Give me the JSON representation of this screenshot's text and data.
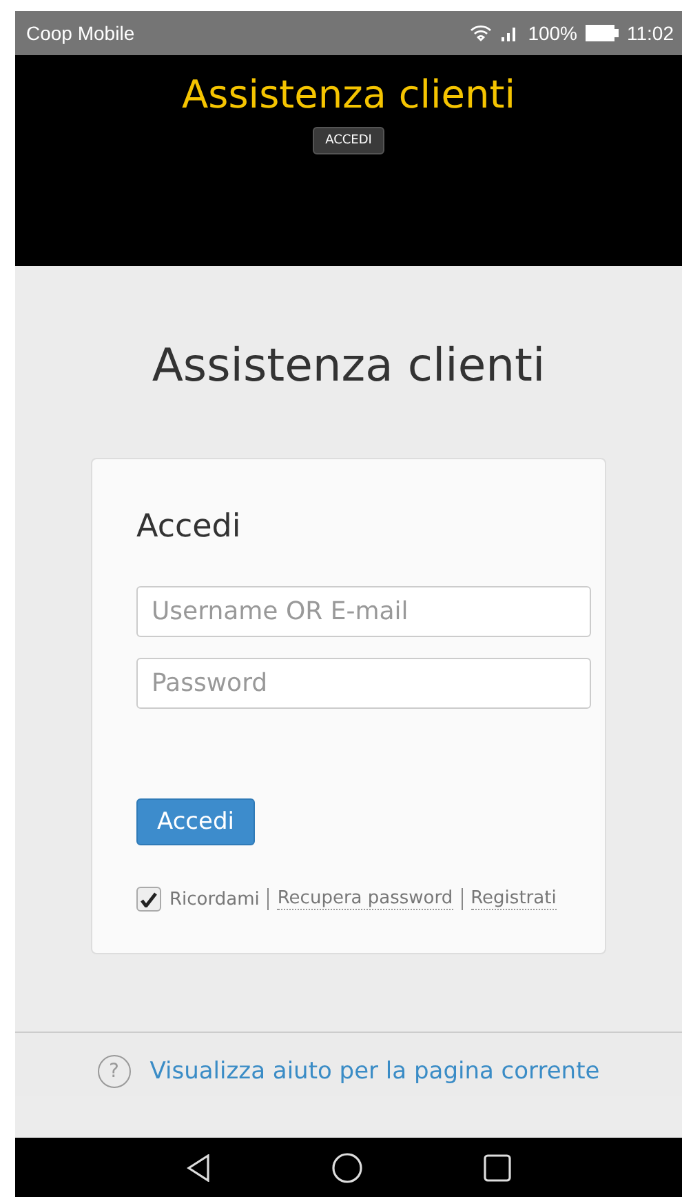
{
  "status_bar": {
    "carrier": "Coop Mobile",
    "battery": "100%",
    "time": "11:02"
  },
  "header": {
    "title": "Assistenza clienti",
    "button": "ACCEDI"
  },
  "page_title": "Assistenza clienti",
  "login": {
    "title": "Accedi",
    "username": {
      "placeholder": "Username OR E-mail"
    },
    "password": {
      "placeholder": "Password"
    },
    "submit": "Accedi",
    "remember": {
      "label": "Ricordami",
      "checked": true
    },
    "links": [
      "Recupera password",
      "Registrati"
    ]
  },
  "footer": {
    "help_link": "Visualizza aiuto per la pagina corrente",
    "help_icon": "?"
  }
}
